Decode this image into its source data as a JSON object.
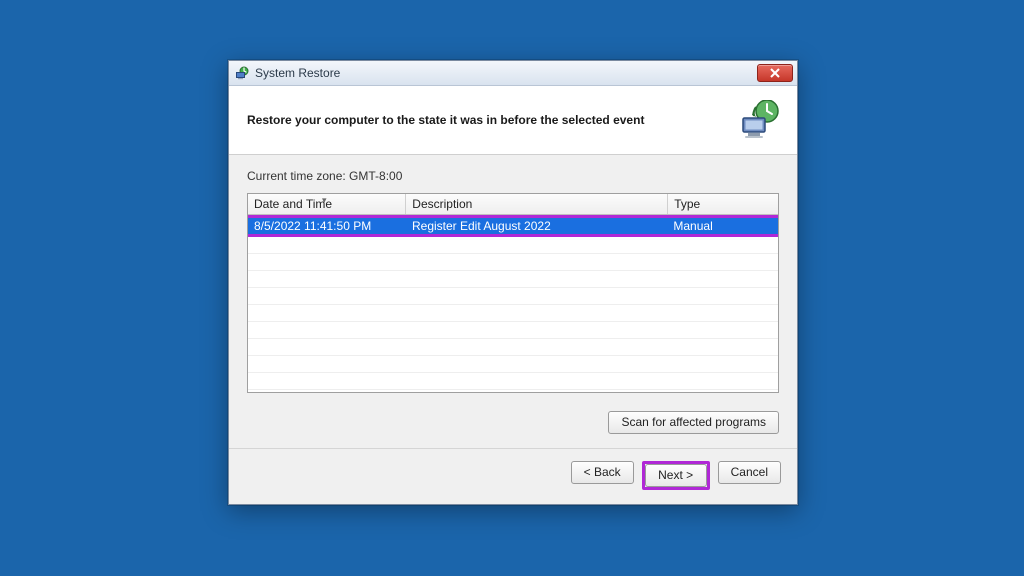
{
  "window": {
    "title": "System Restore",
    "heading": "Restore your computer to the state it was in before the selected event"
  },
  "timezone_label": "Current time zone: GMT-8:00",
  "table": {
    "columns": {
      "datetime": "Date and Time",
      "description": "Description",
      "type": "Type"
    },
    "row": {
      "datetime": "8/5/2022 11:41:50 PM",
      "description": "Register Edit August 2022",
      "type": "Manual"
    }
  },
  "buttons": {
    "scan": "Scan for affected programs",
    "back": "< Back",
    "next": "Next >",
    "cancel": "Cancel"
  }
}
